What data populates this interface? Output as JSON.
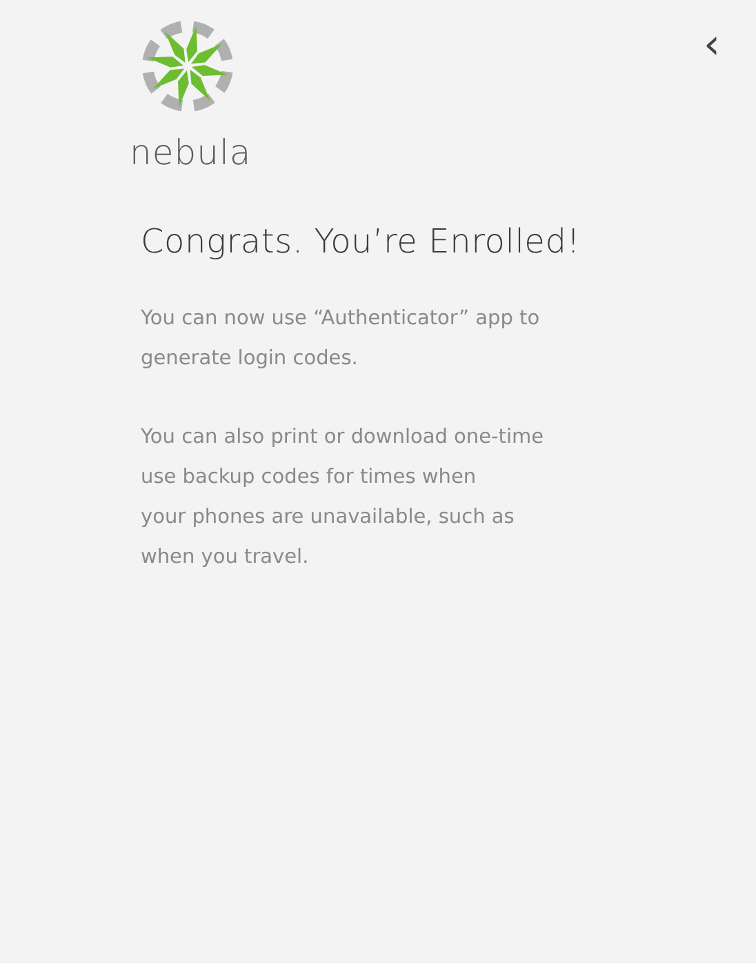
{
  "brand": {
    "name": "nebula"
  },
  "back_button": {
    "label": "‹"
  },
  "heading": "Congrats. You’re Enrolled!",
  "paragraphs": [
    "You can now use “Authenticator” app to\ngenerate login codes.",
    "You can also print or download one-time\nuse backup codes for times when\nyour phones are unavailable, such as\nwhen you travel."
  ]
}
